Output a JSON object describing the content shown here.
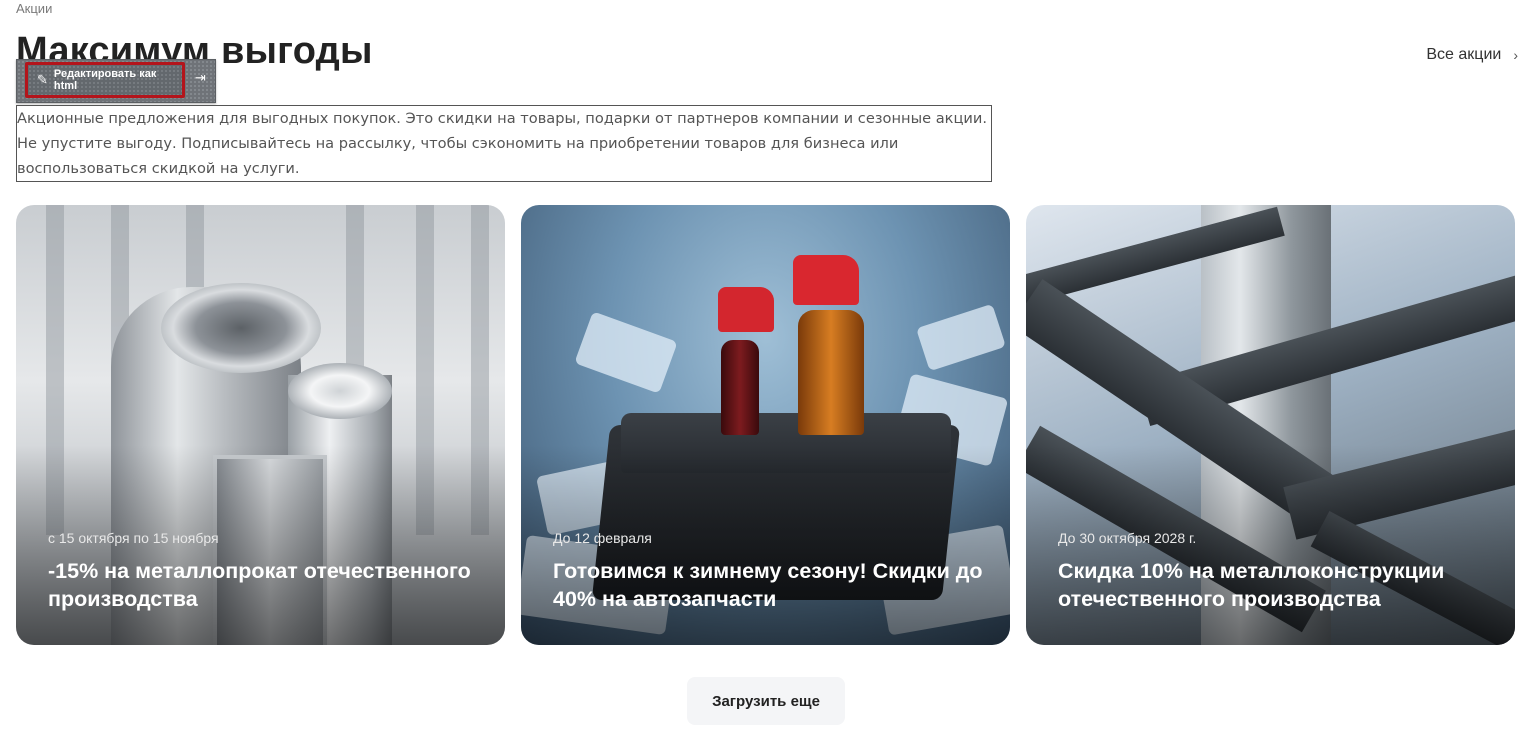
{
  "breadcrumb": "Акции",
  "page_title": "Максимум выгоды",
  "all_link": {
    "label": "Все акции",
    "icon": "chevron-right-icon"
  },
  "edit_toolbar": {
    "edit_label": "Редактировать как html",
    "edit_icon": "pencil-icon",
    "pin_icon": "pin-icon"
  },
  "intro_text": "Акционные предложения для выгодных покупок. Это скидки на товары, подарки от партнеров компании и сезонные акции. Не упустите выгоду. Подписывайтесь на рассылку, чтобы сэкономить на приобретении товаров для бизнеса или воспользоваться скидкой на услуги.",
  "promos": [
    {
      "date": "с 15 октября по 15 ноября",
      "title": "-15% на металлопрокат отечественного производства",
      "image": "metal-pipes"
    },
    {
      "date": "До 12 февраля",
      "title": "Готовимся к зимнему сезону! Скидки до 40% на автозапчасти",
      "image": "battery-on-ice"
    },
    {
      "date": "До 30 октября 2028 г.",
      "title": "Скидка 10% на металлоконструкции отечественного производства",
      "image": "steel-beams"
    }
  ],
  "load_more_label": "Загрузить еще"
}
